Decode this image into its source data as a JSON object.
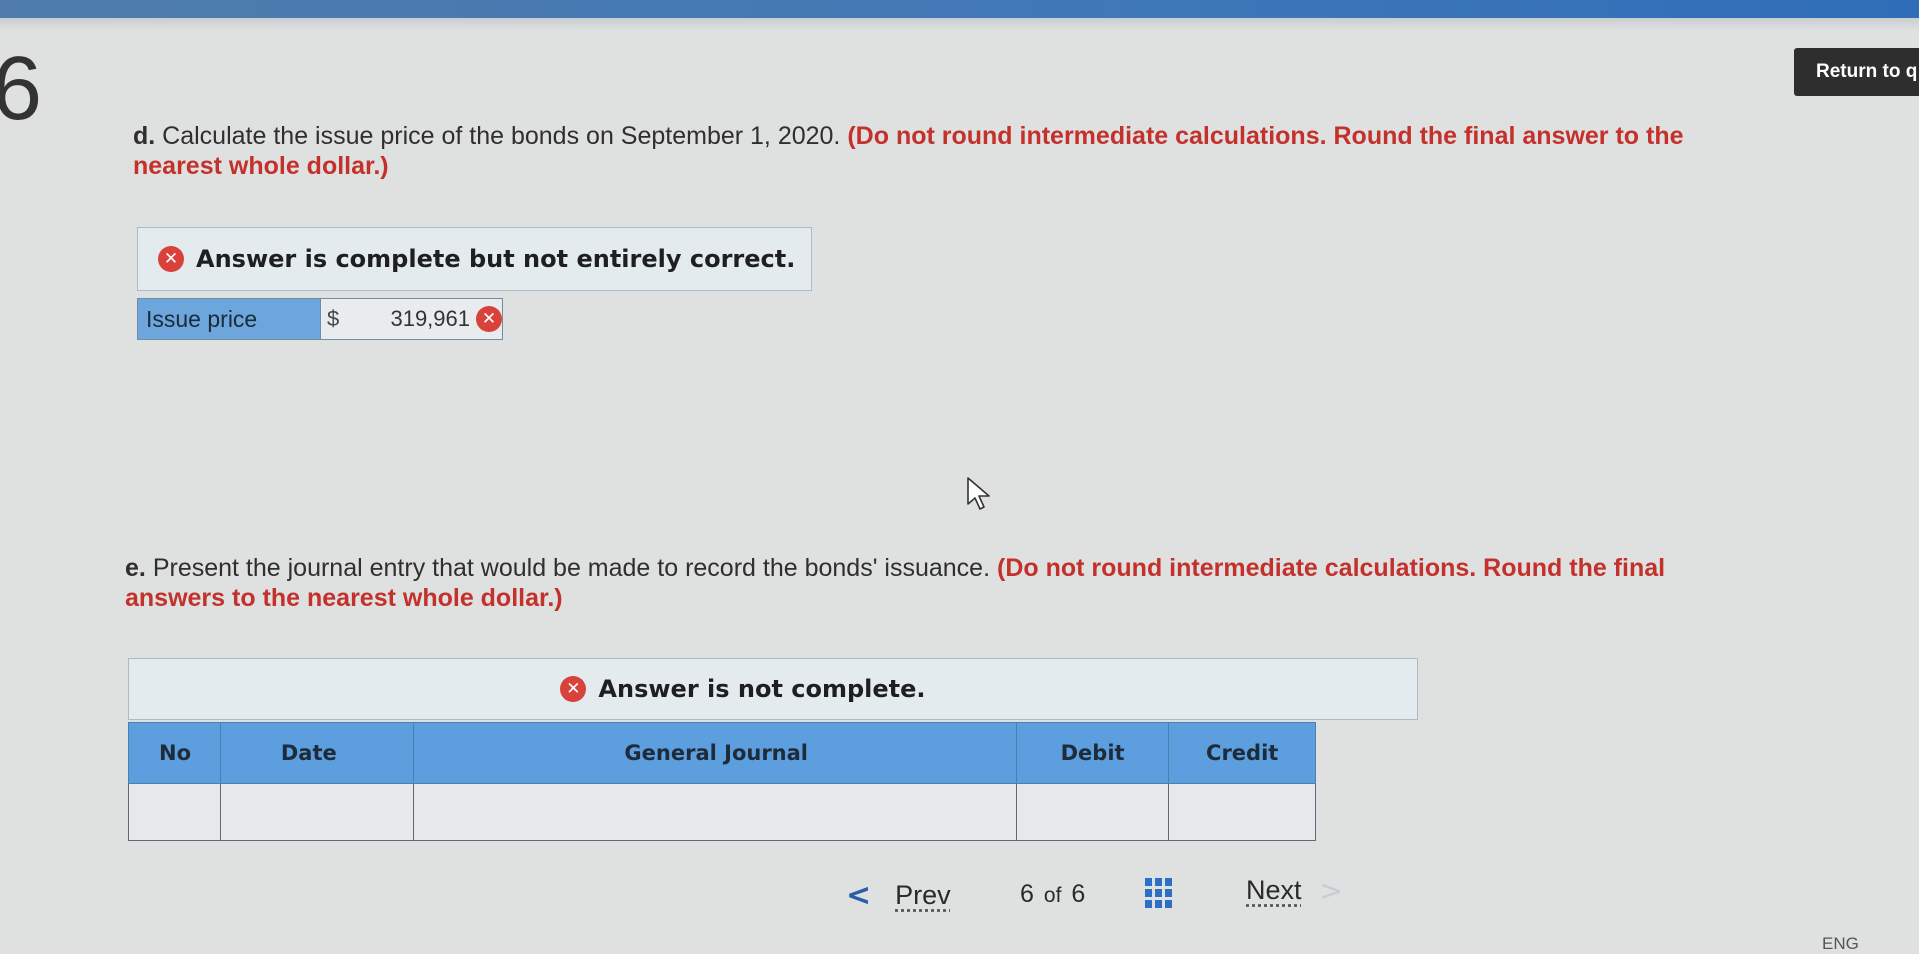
{
  "header": {
    "return_label": "Return to q"
  },
  "question_number": "6",
  "part_d": {
    "label": "d.",
    "text": "Calculate the issue price of the bonds on September 1, 2020.",
    "note": "(Do not round intermediate calculations. Round the final answer to the nearest whole dollar.)",
    "status": "Answer is complete but not entirely correct.",
    "field_label": "Issue price",
    "currency": "$",
    "value": "319,961"
  },
  "part_e": {
    "label": "e.",
    "text": "Present the journal entry that would be made to record the bonds' issuance.",
    "note": "(Do not round intermediate calculations. Round the final answers to the nearest whole dollar.)",
    "status": "Answer is not complete.",
    "columns": [
      "No",
      "Date",
      "General Journal",
      "Debit",
      "Credit"
    ]
  },
  "pager": {
    "prev_label": "Prev",
    "current": "6",
    "of_label": "of",
    "total": "6",
    "next_label": "Next"
  },
  "taskbar": {
    "language": "ENG"
  },
  "colors": {
    "accent_blue": "#5d9ede",
    "error_red": "#d9413b",
    "note_red": "#c4302b"
  }
}
